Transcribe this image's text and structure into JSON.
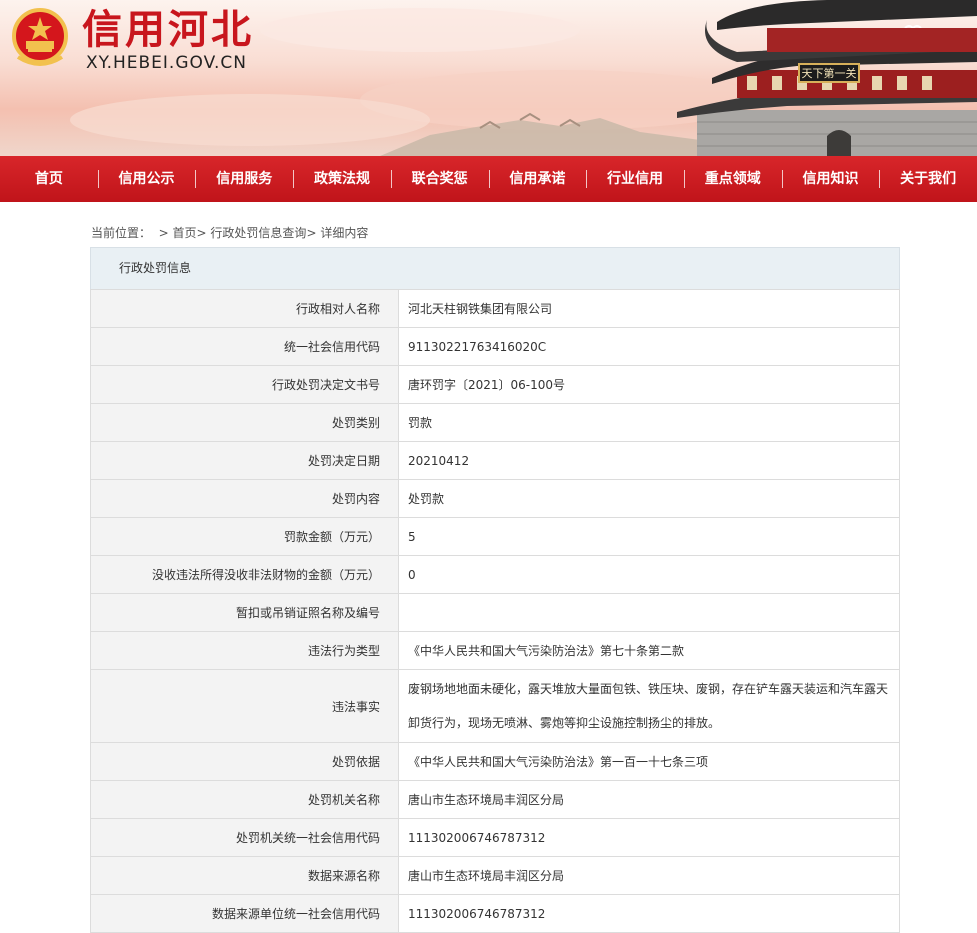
{
  "header": {
    "site_title": "信用河北",
    "site_url": "XY.HEBEI.GOV.CN",
    "emblem_icon": "national-emblem-icon",
    "banner_image": "ancient-gate-tower-illustration",
    "tower_plaque": "天下第一关"
  },
  "nav": {
    "items": [
      {
        "label": "首页"
      },
      {
        "label": "信用公示"
      },
      {
        "label": "信用服务"
      },
      {
        "label": "政策法规"
      },
      {
        "label": "联合奖惩"
      },
      {
        "label": "信用承诺"
      },
      {
        "label": "行业信用"
      },
      {
        "label": "重点领域"
      },
      {
        "label": "信用知识"
      },
      {
        "label": "关于我们"
      }
    ],
    "color": "#c8161d"
  },
  "breadcrumb": {
    "prefix": "当前位置：",
    "items": [
      "首页",
      "行政处罚信息查询",
      "详细内容"
    ]
  },
  "panel": {
    "title": "行政处罚信息",
    "rows": [
      {
        "label": "行政相对人名称",
        "value": "河北天柱钢铁集团有限公司"
      },
      {
        "label": "统一社会信用代码",
        "value": "91130221763416020C"
      },
      {
        "label": "行政处罚决定文书号",
        "value": "唐环罚字〔2021〕06-100号"
      },
      {
        "label": "处罚类别",
        "value": "罚款"
      },
      {
        "label": "处罚决定日期",
        "value": "20210412"
      },
      {
        "label": "处罚内容",
        "value": "处罚款"
      },
      {
        "label": "罚款金额（万元）",
        "value": "5"
      },
      {
        "label": "没收违法所得没收非法财物的金额（万元）",
        "value": "0"
      },
      {
        "label": "暂扣或吊销证照名称及编号",
        "value": ""
      },
      {
        "label": "违法行为类型",
        "value": "《中华人民共和国大气污染防治法》第七十条第二款"
      },
      {
        "label": "违法事实",
        "value_line1": "废钢场地地面未硬化，露天堆放大量面包铁、铁压块、废钢，存在铲车露天装运和汽车露天",
        "value_line2": "卸货行为，现场无喷淋、雾炮等抑尘设施控制扬尘的排放。"
      },
      {
        "label": "处罚依据",
        "value": "《中华人民共和国大气污染防治法》第一百一十七条三项"
      },
      {
        "label": "处罚机关名称",
        "value": "唐山市生态环境局丰润区分局"
      },
      {
        "label": "处罚机关统一社会信用代码",
        "value": "111302006746787312"
      },
      {
        "label": "数据来源名称",
        "value": "唐山市生态环境局丰润区分局"
      },
      {
        "label": "数据来源单位统一社会信用代码",
        "value": "111302006746787312"
      }
    ]
  }
}
